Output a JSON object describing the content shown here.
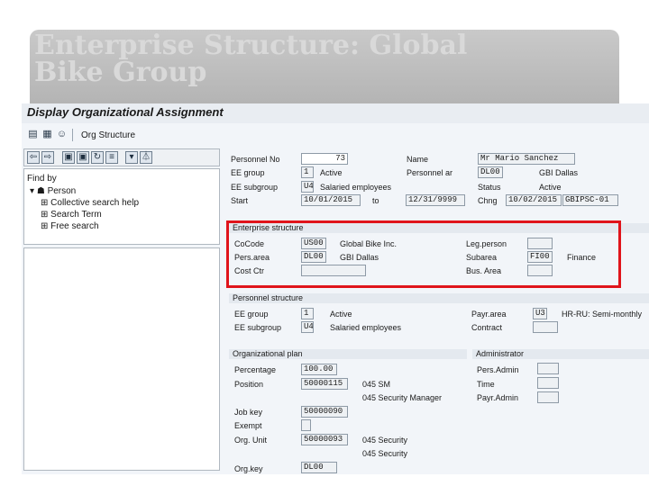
{
  "slide": {
    "title_line1": "Enterprise Structure: Global",
    "title_line2": "Bike Group"
  },
  "window": {
    "title": "Display Organizational Assignment"
  },
  "toolbar": {
    "org_structure_label": "Org Structure"
  },
  "left_panel": {
    "find_by": "Find by",
    "tree": {
      "person": "Person",
      "collective_search": "Collective search help",
      "search_term": "Search Term",
      "free_search": "Free search"
    },
    "dots": "....."
  },
  "header": {
    "personnel_no_label": "Personnel No",
    "personnel_no": "73",
    "name_label": "Name",
    "name": "Mr Mario Sanchez",
    "ee_group_label": "EE group",
    "ee_group": "1",
    "ee_group_text": "Active",
    "personnel_ar_label": "Personnel ar",
    "personnel_ar": "DL00",
    "personnel_ar_text": "GBI Dallas",
    "ee_subgroup_label": "EE subgroup",
    "ee_subgroup": "U4",
    "ee_subgroup_text": "Salaried employees",
    "status_label": "Status",
    "status": "Active",
    "start_label": "Start",
    "start": "10/01/2015",
    "to_label": "to",
    "end": "12/31/9999",
    "chng_label": "Chng",
    "chng": "10/02/2015",
    "chng_user": "GBIPSC-01"
  },
  "enterprise_structure": {
    "title": "Enterprise structure",
    "cocode_label": "CoCode",
    "cocode": "US00",
    "cocode_text": "Global Bike Inc.",
    "pers_area_label": "Pers.area",
    "pers_area": "DL00",
    "pers_area_text": "GBI Dallas",
    "cost_ctr_label": "Cost Ctr",
    "leg_person_label": "Leg.person",
    "subarea_label": "Subarea",
    "subarea": "FI00",
    "subarea_text": "Finance",
    "bus_area_label": "Bus. Area"
  },
  "personnel_structure": {
    "title": "Personnel structure",
    "ee_group_label": "EE group",
    "ee_group": "1",
    "ee_group_text": "Active",
    "ee_subgroup_label": "EE subgroup",
    "ee_subgroup": "U4",
    "ee_subgroup_text": "Salaried employees",
    "payr_area_label": "Payr.area",
    "payr_area": "U3",
    "payr_area_text": "HR-RU: Semi-monthly",
    "contract_label": "Contract"
  },
  "organizational_plan": {
    "title": "Organizational plan",
    "percentage_label": "Percentage",
    "percentage": "100.00",
    "position_label": "Position",
    "position": "50000115",
    "position_text1": "045 SM",
    "position_text2": "045 Security Manager",
    "job_key_label": "Job key",
    "job_key": "50000090",
    "exempt_label": "Exempt",
    "org_unit_label": "Org. Unit",
    "org_unit": "50000093",
    "org_unit_text1": "045 Security",
    "org_unit_text2": "045 Security",
    "org_key_label": "Org.key",
    "org_key": "DL00"
  },
  "administrator": {
    "title": "Administrator",
    "pers_admin_label": "Pers.Admin",
    "time_label": "Time",
    "payr_admin_label": "Payr.Admin"
  },
  "colors": {
    "highlight": "#e0141b",
    "title_text": "#d9d9d9",
    "card": "#c0c0c0"
  }
}
